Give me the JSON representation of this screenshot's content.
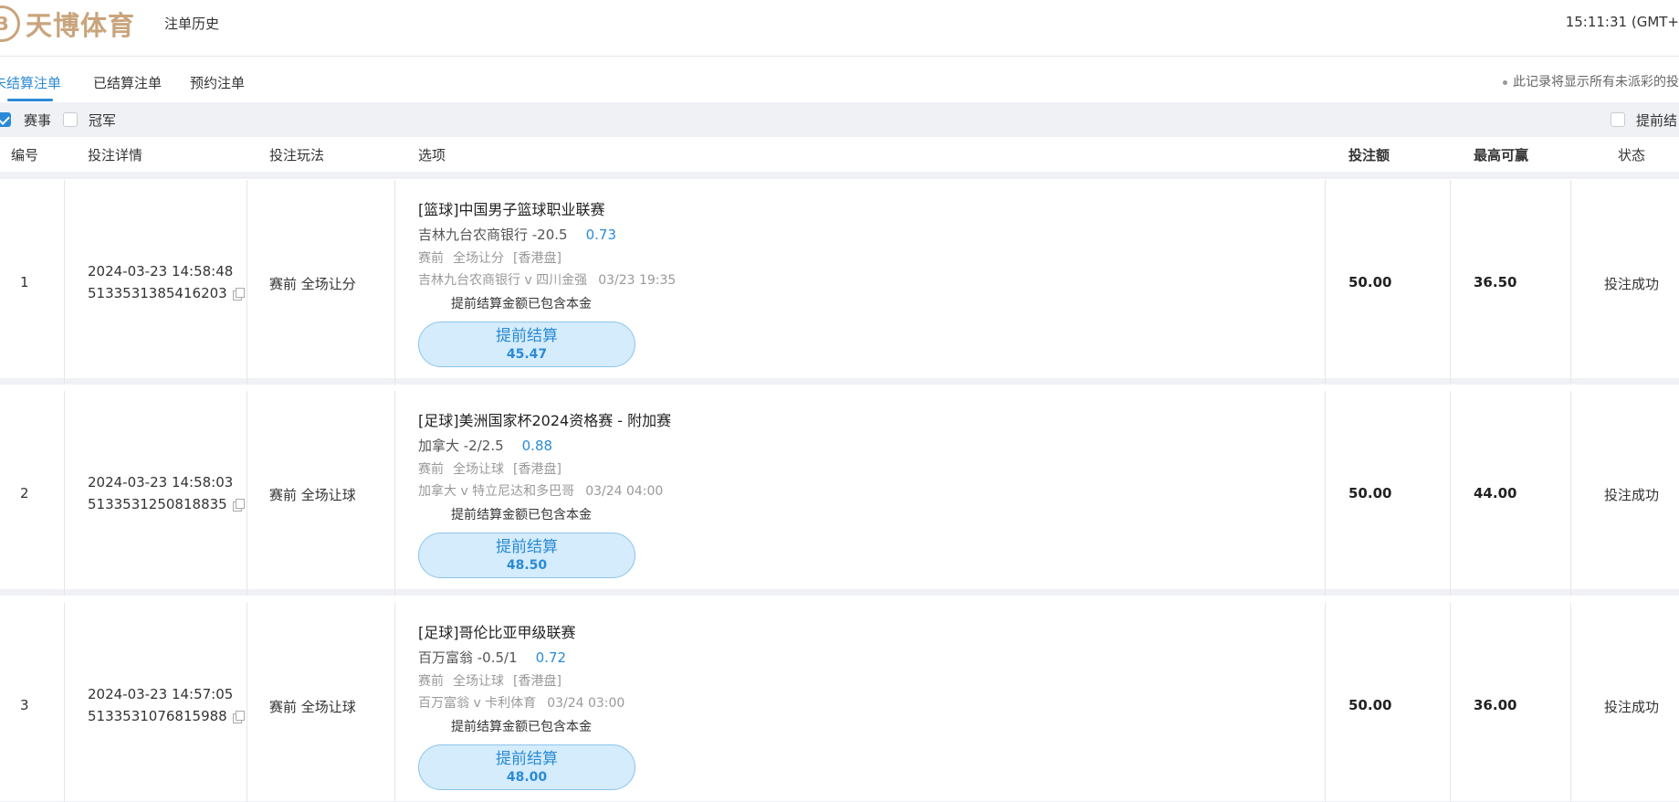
{
  "header": {
    "logo_mark": "B",
    "logo_text": "天博体育",
    "history_link": "注单历史",
    "clock": "15:11:31 (GMT+"
  },
  "tabs": [
    {
      "label": "未结算注单",
      "active": true
    },
    {
      "label": "已结算注单",
      "active": false
    },
    {
      "label": "预约注单",
      "active": false
    }
  ],
  "notice": "此记录将显示所有未派彩的投",
  "filters": {
    "event": {
      "label": "赛事",
      "checked": true
    },
    "outright": {
      "label": "冠军",
      "checked": false
    },
    "cashout": {
      "label": "提前结",
      "checked": false
    }
  },
  "columns": {
    "no": "编号",
    "detail": "投注详情",
    "play": "投注玩法",
    "selection": "选项",
    "stake": "投注额",
    "max_win": "最高可赢",
    "status": "状态"
  },
  "rows": [
    {
      "no": "1",
      "datetime": "2024-03-23 14:58:48",
      "bet_id": "5133531385416203",
      "play": "赛前 全场让分",
      "league": "[篮球]中国男子篮球职业联赛",
      "pick": "吉林九台农商银行 -20.5",
      "odds": "0.73",
      "type_1": "赛前",
      "type_2": "全场让分",
      "type_3": "[香港盘]",
      "match": "吉林九台农商银行 v 四川金强",
      "match_time": "03/23 19:35",
      "note": "提前结算金额已包含本金",
      "cashout_label": "提前结算",
      "cashout_amount": "45.47",
      "stake": "50.00",
      "max_win": "36.50",
      "status": "投注成功"
    },
    {
      "no": "2",
      "datetime": "2024-03-23 14:58:03",
      "bet_id": "5133531250818835",
      "play": "赛前 全场让球",
      "league": "[足球]美洲国家杯2024资格赛 - 附加赛",
      "pick": "加拿大 -2/2.5",
      "odds": "0.88",
      "type_1": "赛前",
      "type_2": "全场让球",
      "type_3": "[香港盘]",
      "match": "加拿大 v 特立尼达和多巴哥",
      "match_time": "03/24 04:00",
      "note": "提前结算金额已包含本金",
      "cashout_label": "提前结算",
      "cashout_amount": "48.50",
      "stake": "50.00",
      "max_win": "44.00",
      "status": "投注成功"
    },
    {
      "no": "3",
      "datetime": "2024-03-23 14:57:05",
      "bet_id": "5133531076815988",
      "play": "赛前 全场让球",
      "league": "[足球]哥伦比亚甲级联赛",
      "pick": "百万富翁 -0.5/1",
      "odds": "0.72",
      "type_1": "赛前",
      "type_2": "全场让球",
      "type_3": "[香港盘]",
      "match": "百万富翁 v 卡利体育",
      "match_time": "03/24 03:00",
      "note": "提前结算金额已包含本金",
      "cashout_label": "提前结算",
      "cashout_amount": "48.00",
      "stake": "50.00",
      "max_win": "36.00",
      "status": "投注成功"
    }
  ]
}
